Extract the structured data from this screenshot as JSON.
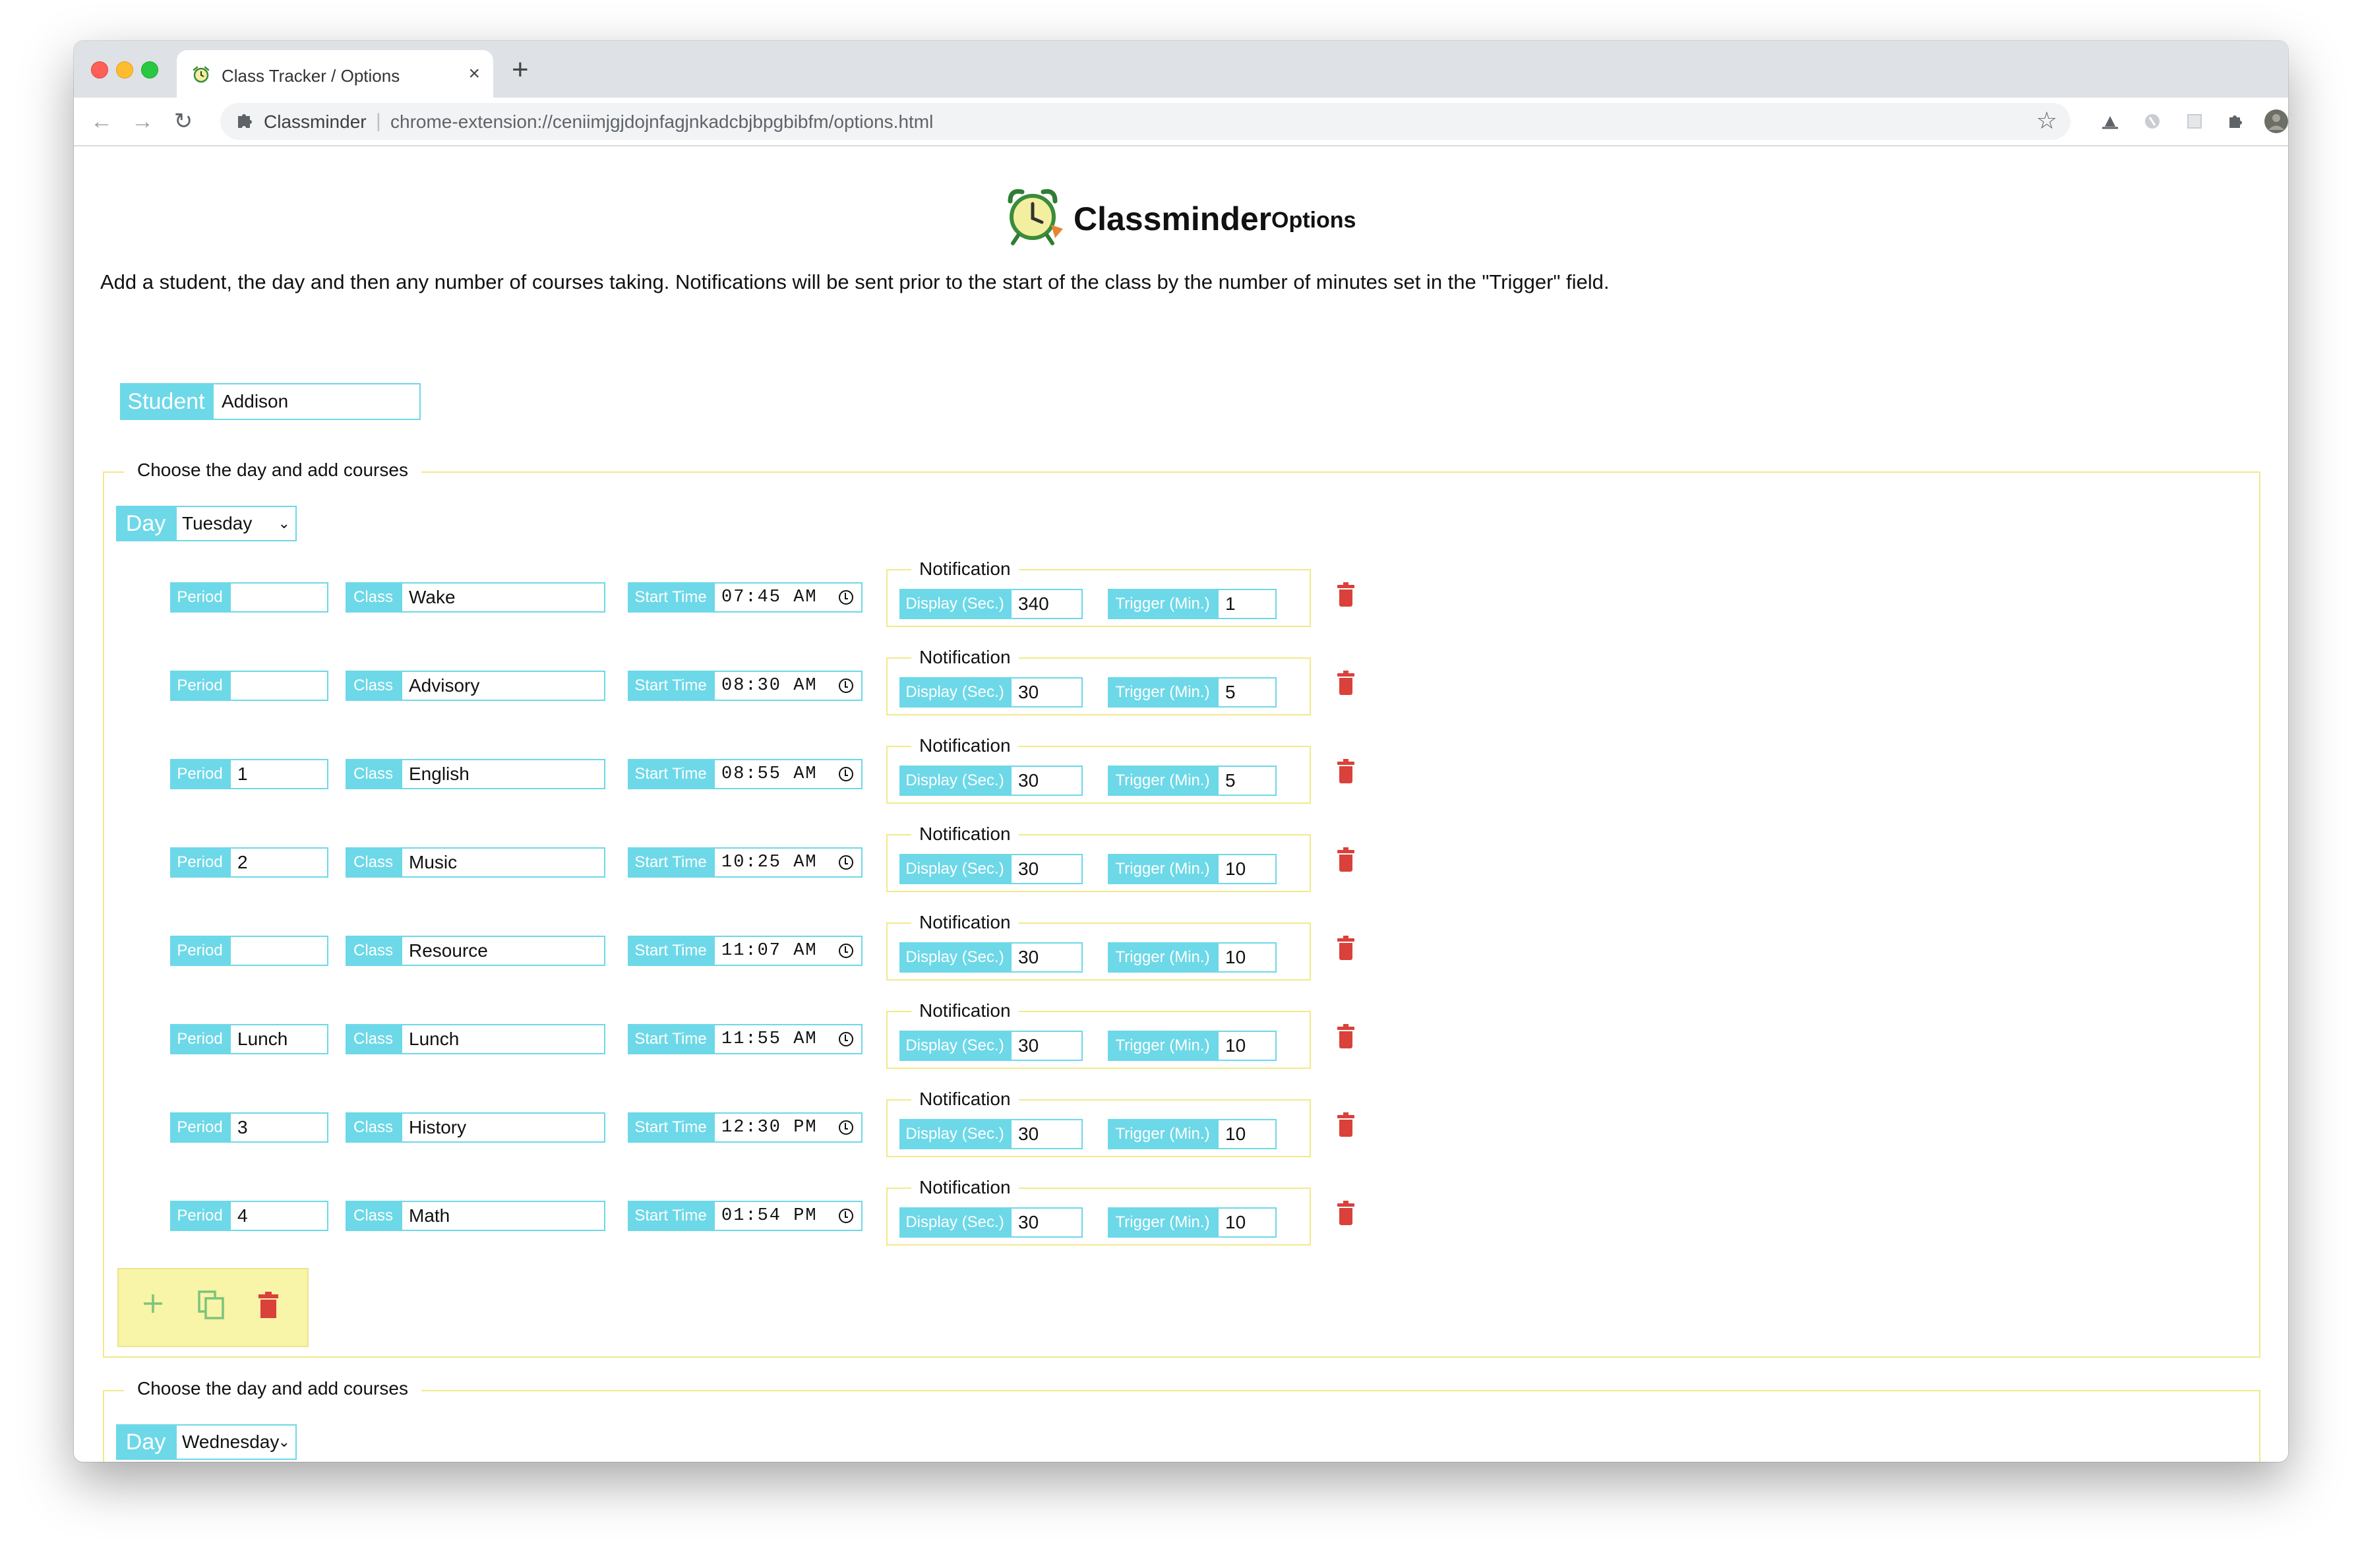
{
  "browser": {
    "tab_title": "Class Tracker / Options",
    "tab_close": "×",
    "new_tab": "+",
    "omnibox_site": "Classminder",
    "omnibox_separator": "|",
    "url": "chrome-extension://ceniimjgjdojnfagjnkadcbjbpgbibfm/options.html",
    "nav": {
      "back": "←",
      "forward": "→",
      "reload": "↻"
    },
    "star": "☆",
    "more": "⋮"
  },
  "header": {
    "app_name": "Classminder",
    "subtitle": "Options"
  },
  "intro": "Add a student, the day and then any number of courses taking. Notifications will be sent prior to the start of the class by the number of minutes set in the \"Trigger\" field.",
  "student": {
    "label": "Student",
    "value": "Addison"
  },
  "labels": {
    "legend": "Choose the day and add courses",
    "day": "Day",
    "period": "Period",
    "class": "Class",
    "start_time": "Start Time",
    "notification": "Notification",
    "display": "Display (Sec.)",
    "trigger": "Trigger (Min.)"
  },
  "days": [
    {
      "day": "Tuesday",
      "courses": [
        {
          "period": "",
          "class": "Wake",
          "time": "07:45 AM",
          "display": "340",
          "trigger": "1"
        },
        {
          "period": "",
          "class": "Advisory",
          "time": "08:30 AM",
          "display": "30",
          "trigger": "5"
        },
        {
          "period": "1",
          "class": "English",
          "time": "08:55 AM",
          "display": "30",
          "trigger": "5"
        },
        {
          "period": "2",
          "class": "Music",
          "time": "10:25 AM",
          "display": "30",
          "trigger": "10"
        },
        {
          "period": "",
          "class": "Resource",
          "time": "11:07 AM",
          "display": "30",
          "trigger": "10"
        },
        {
          "period": "Lunch",
          "class": "Lunch",
          "time": "11:55 AM",
          "display": "30",
          "trigger": "10"
        },
        {
          "period": "3",
          "class": "History",
          "time": "12:30 PM",
          "display": "30",
          "trigger": "10"
        },
        {
          "period": "4",
          "class": "Math",
          "time": "01:54 PM",
          "display": "30",
          "trigger": "10"
        }
      ]
    },
    {
      "day": "Wednesday",
      "courses": []
    }
  ],
  "icons": {
    "add": "add-icon",
    "copy": "copy-icon",
    "delete": "trash-icon"
  },
  "colors": {
    "label_bg": "#6dd8e8",
    "fieldset_border": "#f2e98a",
    "action_bg": "#f8f4a8",
    "trash": "#d9413a",
    "add": "#7cc47a"
  }
}
